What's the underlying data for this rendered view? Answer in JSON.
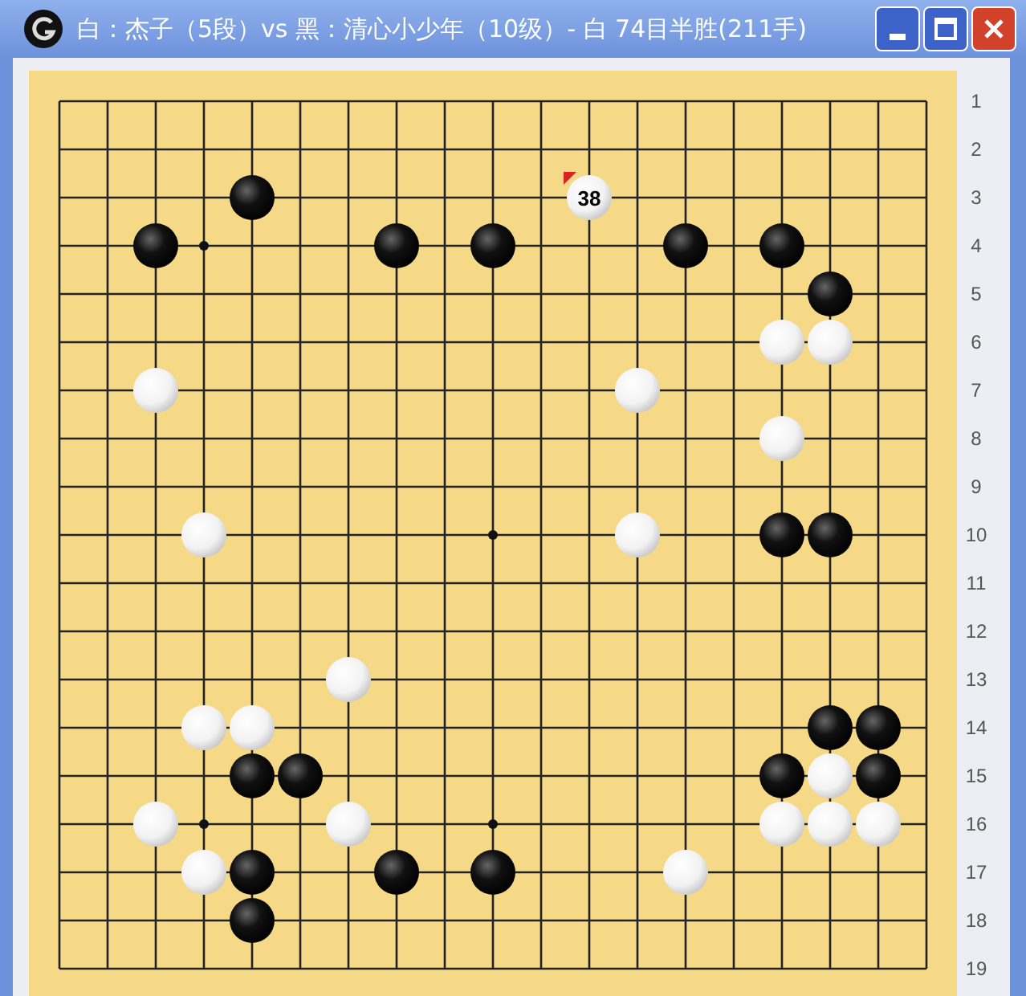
{
  "window": {
    "title": "白：杰子（5段）vs 黑：清心小少年（10级）- 白 74目半胜(211手)"
  },
  "board": {
    "rows": [
      {
        "label": "1",
        "points": [
          {
            "kind": "empty"
          },
          {
            "kind": "empty"
          },
          {
            "kind": "empty"
          },
          {
            "kind": "empty"
          },
          {
            "kind": "empty"
          },
          {
            "kind": "empty"
          },
          {
            "kind": "empty"
          },
          {
            "kind": "empty"
          },
          {
            "kind": "empty"
          },
          {
            "kind": "empty"
          },
          {
            "kind": "empty"
          },
          {
            "kind": "empty"
          },
          {
            "kind": "empty"
          },
          {
            "kind": "empty"
          },
          {
            "kind": "empty"
          },
          {
            "kind": "empty"
          },
          {
            "kind": "empty"
          },
          {
            "kind": "empty"
          },
          {
            "kind": "empty"
          }
        ]
      },
      {
        "label": "2",
        "points": [
          {
            "kind": "empty"
          },
          {
            "kind": "empty"
          },
          {
            "kind": "empty"
          },
          {
            "kind": "empty"
          },
          {
            "kind": "empty"
          },
          {
            "kind": "empty"
          },
          {
            "kind": "empty"
          },
          {
            "kind": "empty"
          },
          {
            "kind": "empty"
          },
          {
            "kind": "empty"
          },
          {
            "kind": "empty"
          },
          {
            "kind": "empty"
          },
          {
            "kind": "empty"
          },
          {
            "kind": "empty"
          },
          {
            "kind": "empty"
          },
          {
            "kind": "empty"
          },
          {
            "kind": "empty"
          },
          {
            "kind": "empty"
          },
          {
            "kind": "empty"
          }
        ]
      },
      {
        "label": "3",
        "points": [
          {
            "kind": "empty"
          },
          {
            "kind": "empty"
          },
          {
            "kind": "empty"
          },
          {
            "kind": "empty"
          },
          {
            "kind": "black",
            "last_move": false
          },
          {
            "kind": "empty"
          },
          {
            "kind": "empty"
          },
          {
            "kind": "empty"
          },
          {
            "kind": "empty"
          },
          {
            "kind": "empty"
          },
          {
            "kind": "empty"
          },
          {
            "kind": "white",
            "last_move": true,
            "label": "38"
          },
          {
            "kind": "empty"
          },
          {
            "kind": "empty"
          },
          {
            "kind": "empty"
          },
          {
            "kind": "empty"
          },
          {
            "kind": "empty"
          },
          {
            "kind": "empty"
          },
          {
            "kind": "empty"
          }
        ]
      },
      {
        "label": "4",
        "points": [
          {
            "kind": "empty"
          },
          {
            "kind": "empty"
          },
          {
            "kind": "black",
            "last_move": false
          },
          {
            "kind": "empty"
          },
          {
            "kind": "empty"
          },
          {
            "kind": "empty"
          },
          {
            "kind": "empty"
          },
          {
            "kind": "black",
            "last_move": false
          },
          {
            "kind": "empty"
          },
          {
            "kind": "black",
            "last_move": false
          },
          {
            "kind": "empty"
          },
          {
            "kind": "empty"
          },
          {
            "kind": "empty"
          },
          {
            "kind": "black",
            "last_move": false
          },
          {
            "kind": "empty"
          },
          {
            "kind": "black",
            "last_move": false
          },
          {
            "kind": "empty"
          },
          {
            "kind": "empty"
          },
          {
            "kind": "empty"
          }
        ]
      },
      {
        "label": "5",
        "points": [
          {
            "kind": "empty"
          },
          {
            "kind": "empty"
          },
          {
            "kind": "empty"
          },
          {
            "kind": "empty"
          },
          {
            "kind": "empty"
          },
          {
            "kind": "empty"
          },
          {
            "kind": "empty"
          },
          {
            "kind": "empty"
          },
          {
            "kind": "empty"
          },
          {
            "kind": "empty"
          },
          {
            "kind": "empty"
          },
          {
            "kind": "empty"
          },
          {
            "kind": "empty"
          },
          {
            "kind": "empty"
          },
          {
            "kind": "empty"
          },
          {
            "kind": "empty"
          },
          {
            "kind": "black",
            "last_move": false
          },
          {
            "kind": "empty"
          },
          {
            "kind": "empty"
          }
        ]
      },
      {
        "label": "6",
        "points": [
          {
            "kind": "empty"
          },
          {
            "kind": "empty"
          },
          {
            "kind": "empty"
          },
          {
            "kind": "empty"
          },
          {
            "kind": "empty"
          },
          {
            "kind": "empty"
          },
          {
            "kind": "empty"
          },
          {
            "kind": "empty"
          },
          {
            "kind": "empty"
          },
          {
            "kind": "empty"
          },
          {
            "kind": "empty"
          },
          {
            "kind": "empty"
          },
          {
            "kind": "empty"
          },
          {
            "kind": "empty"
          },
          {
            "kind": "empty"
          },
          {
            "kind": "white",
            "last_move": false
          },
          {
            "kind": "white",
            "last_move": false
          },
          {
            "kind": "empty"
          },
          {
            "kind": "empty"
          }
        ]
      },
      {
        "label": "7",
        "points": [
          {
            "kind": "empty"
          },
          {
            "kind": "empty"
          },
          {
            "kind": "white",
            "last_move": false
          },
          {
            "kind": "empty"
          },
          {
            "kind": "empty"
          },
          {
            "kind": "empty"
          },
          {
            "kind": "empty"
          },
          {
            "kind": "empty"
          },
          {
            "kind": "empty"
          },
          {
            "kind": "empty"
          },
          {
            "kind": "empty"
          },
          {
            "kind": "empty"
          },
          {
            "kind": "white",
            "last_move": false
          },
          {
            "kind": "empty"
          },
          {
            "kind": "empty"
          },
          {
            "kind": "empty"
          },
          {
            "kind": "empty"
          },
          {
            "kind": "empty"
          },
          {
            "kind": "empty"
          }
        ]
      },
      {
        "label": "8",
        "points": [
          {
            "kind": "empty"
          },
          {
            "kind": "empty"
          },
          {
            "kind": "empty"
          },
          {
            "kind": "empty"
          },
          {
            "kind": "empty"
          },
          {
            "kind": "empty"
          },
          {
            "kind": "empty"
          },
          {
            "kind": "empty"
          },
          {
            "kind": "empty"
          },
          {
            "kind": "empty"
          },
          {
            "kind": "empty"
          },
          {
            "kind": "empty"
          },
          {
            "kind": "empty"
          },
          {
            "kind": "empty"
          },
          {
            "kind": "empty"
          },
          {
            "kind": "white",
            "last_move": false
          },
          {
            "kind": "empty"
          },
          {
            "kind": "empty"
          },
          {
            "kind": "empty"
          }
        ]
      },
      {
        "label": "9",
        "points": [
          {
            "kind": "empty"
          },
          {
            "kind": "empty"
          },
          {
            "kind": "empty"
          },
          {
            "kind": "empty"
          },
          {
            "kind": "empty"
          },
          {
            "kind": "empty"
          },
          {
            "kind": "empty"
          },
          {
            "kind": "empty"
          },
          {
            "kind": "empty"
          },
          {
            "kind": "empty"
          },
          {
            "kind": "empty"
          },
          {
            "kind": "empty"
          },
          {
            "kind": "empty"
          },
          {
            "kind": "empty"
          },
          {
            "kind": "empty"
          },
          {
            "kind": "empty"
          },
          {
            "kind": "empty"
          },
          {
            "kind": "empty"
          },
          {
            "kind": "empty"
          }
        ]
      },
      {
        "label": "10",
        "points": [
          {
            "kind": "empty"
          },
          {
            "kind": "empty"
          },
          {
            "kind": "empty"
          },
          {
            "kind": "white",
            "last_move": false
          },
          {
            "kind": "empty"
          },
          {
            "kind": "empty"
          },
          {
            "kind": "empty"
          },
          {
            "kind": "empty"
          },
          {
            "kind": "empty"
          },
          {
            "kind": "empty"
          },
          {
            "kind": "empty"
          },
          {
            "kind": "empty"
          },
          {
            "kind": "white",
            "last_move": false
          },
          {
            "kind": "empty"
          },
          {
            "kind": "empty"
          },
          {
            "kind": "black",
            "last_move": false
          },
          {
            "kind": "black",
            "last_move": false
          },
          {
            "kind": "empty"
          },
          {
            "kind": "empty"
          }
        ]
      },
      {
        "label": "11",
        "points": [
          {
            "kind": "empty"
          },
          {
            "kind": "empty"
          },
          {
            "kind": "empty"
          },
          {
            "kind": "empty"
          },
          {
            "kind": "empty"
          },
          {
            "kind": "empty"
          },
          {
            "kind": "empty"
          },
          {
            "kind": "empty"
          },
          {
            "kind": "empty"
          },
          {
            "kind": "empty"
          },
          {
            "kind": "empty"
          },
          {
            "kind": "empty"
          },
          {
            "kind": "empty"
          },
          {
            "kind": "empty"
          },
          {
            "kind": "empty"
          },
          {
            "kind": "empty"
          },
          {
            "kind": "empty"
          },
          {
            "kind": "empty"
          },
          {
            "kind": "empty"
          }
        ]
      },
      {
        "label": "12",
        "points": [
          {
            "kind": "empty"
          },
          {
            "kind": "empty"
          },
          {
            "kind": "empty"
          },
          {
            "kind": "empty"
          },
          {
            "kind": "empty"
          },
          {
            "kind": "empty"
          },
          {
            "kind": "empty"
          },
          {
            "kind": "empty"
          },
          {
            "kind": "empty"
          },
          {
            "kind": "empty"
          },
          {
            "kind": "empty"
          },
          {
            "kind": "empty"
          },
          {
            "kind": "empty"
          },
          {
            "kind": "empty"
          },
          {
            "kind": "empty"
          },
          {
            "kind": "empty"
          },
          {
            "kind": "empty"
          },
          {
            "kind": "empty"
          },
          {
            "kind": "empty"
          }
        ]
      },
      {
        "label": "13",
        "points": [
          {
            "kind": "empty"
          },
          {
            "kind": "empty"
          },
          {
            "kind": "empty"
          },
          {
            "kind": "empty"
          },
          {
            "kind": "empty"
          },
          {
            "kind": "empty"
          },
          {
            "kind": "white",
            "last_move": false
          },
          {
            "kind": "empty"
          },
          {
            "kind": "empty"
          },
          {
            "kind": "empty"
          },
          {
            "kind": "empty"
          },
          {
            "kind": "empty"
          },
          {
            "kind": "empty"
          },
          {
            "kind": "empty"
          },
          {
            "kind": "empty"
          },
          {
            "kind": "empty"
          },
          {
            "kind": "empty"
          },
          {
            "kind": "empty"
          },
          {
            "kind": "empty"
          }
        ]
      },
      {
        "label": "14",
        "points": [
          {
            "kind": "empty"
          },
          {
            "kind": "empty"
          },
          {
            "kind": "empty"
          },
          {
            "kind": "white",
            "last_move": false
          },
          {
            "kind": "white",
            "last_move": false
          },
          {
            "kind": "empty"
          },
          {
            "kind": "empty"
          },
          {
            "kind": "empty"
          },
          {
            "kind": "empty"
          },
          {
            "kind": "empty"
          },
          {
            "kind": "empty"
          },
          {
            "kind": "empty"
          },
          {
            "kind": "empty"
          },
          {
            "kind": "empty"
          },
          {
            "kind": "empty"
          },
          {
            "kind": "empty"
          },
          {
            "kind": "black",
            "last_move": false
          },
          {
            "kind": "black",
            "last_move": false
          },
          {
            "kind": "empty"
          }
        ]
      },
      {
        "label": "15",
        "points": [
          {
            "kind": "empty"
          },
          {
            "kind": "empty"
          },
          {
            "kind": "empty"
          },
          {
            "kind": "empty"
          },
          {
            "kind": "black",
            "last_move": false
          },
          {
            "kind": "black",
            "last_move": false
          },
          {
            "kind": "empty"
          },
          {
            "kind": "empty"
          },
          {
            "kind": "empty"
          },
          {
            "kind": "empty"
          },
          {
            "kind": "empty"
          },
          {
            "kind": "empty"
          },
          {
            "kind": "empty"
          },
          {
            "kind": "empty"
          },
          {
            "kind": "empty"
          },
          {
            "kind": "black",
            "last_move": false
          },
          {
            "kind": "white",
            "last_move": false
          },
          {
            "kind": "black",
            "last_move": false
          },
          {
            "kind": "empty"
          }
        ]
      },
      {
        "label": "16",
        "points": [
          {
            "kind": "empty"
          },
          {
            "kind": "empty"
          },
          {
            "kind": "white",
            "last_move": false
          },
          {
            "kind": "empty"
          },
          {
            "kind": "empty"
          },
          {
            "kind": "empty"
          },
          {
            "kind": "white",
            "last_move": false
          },
          {
            "kind": "empty"
          },
          {
            "kind": "empty"
          },
          {
            "kind": "empty"
          },
          {
            "kind": "empty"
          },
          {
            "kind": "empty"
          },
          {
            "kind": "empty"
          },
          {
            "kind": "empty"
          },
          {
            "kind": "empty"
          },
          {
            "kind": "white",
            "last_move": false
          },
          {
            "kind": "white",
            "last_move": false
          },
          {
            "kind": "white",
            "last_move": false
          },
          {
            "kind": "empty"
          }
        ]
      },
      {
        "label": "17",
        "points": [
          {
            "kind": "empty"
          },
          {
            "kind": "empty"
          },
          {
            "kind": "empty"
          },
          {
            "kind": "white",
            "last_move": false
          },
          {
            "kind": "black",
            "last_move": false
          },
          {
            "kind": "empty"
          },
          {
            "kind": "empty"
          },
          {
            "kind": "black",
            "last_move": false
          },
          {
            "kind": "empty"
          },
          {
            "kind": "black",
            "last_move": false
          },
          {
            "kind": "empty"
          },
          {
            "kind": "empty"
          },
          {
            "kind": "empty"
          },
          {
            "kind": "white",
            "last_move": false
          },
          {
            "kind": "empty"
          },
          {
            "kind": "empty"
          },
          {
            "kind": "empty"
          },
          {
            "kind": "empty"
          },
          {
            "kind": "empty"
          }
        ]
      },
      {
        "label": "18",
        "points": [
          {
            "kind": "empty"
          },
          {
            "kind": "empty"
          },
          {
            "kind": "empty"
          },
          {
            "kind": "empty"
          },
          {
            "kind": "black",
            "last_move": false
          },
          {
            "kind": "empty"
          },
          {
            "kind": "empty"
          },
          {
            "kind": "empty"
          },
          {
            "kind": "empty"
          },
          {
            "kind": "empty"
          },
          {
            "kind": "empty"
          },
          {
            "kind": "empty"
          },
          {
            "kind": "empty"
          },
          {
            "kind": "empty"
          },
          {
            "kind": "empty"
          },
          {
            "kind": "empty"
          },
          {
            "kind": "empty"
          },
          {
            "kind": "empty"
          },
          {
            "kind": "empty"
          }
        ]
      },
      {
        "label": "19",
        "points": [
          {
            "kind": "empty"
          },
          {
            "kind": "empty"
          },
          {
            "kind": "empty"
          },
          {
            "kind": "empty"
          },
          {
            "kind": "empty"
          },
          {
            "kind": "empty"
          },
          {
            "kind": "empty"
          },
          {
            "kind": "empty"
          },
          {
            "kind": "empty"
          },
          {
            "kind": "empty"
          },
          {
            "kind": "empty"
          },
          {
            "kind": "empty"
          },
          {
            "kind": "empty"
          },
          {
            "kind": "empty"
          },
          {
            "kind": "empty"
          },
          {
            "kind": "empty"
          },
          {
            "kind": "empty"
          },
          {
            "kind": "empty"
          },
          {
            "kind": "empty"
          }
        ]
      }
    ]
  }
}
